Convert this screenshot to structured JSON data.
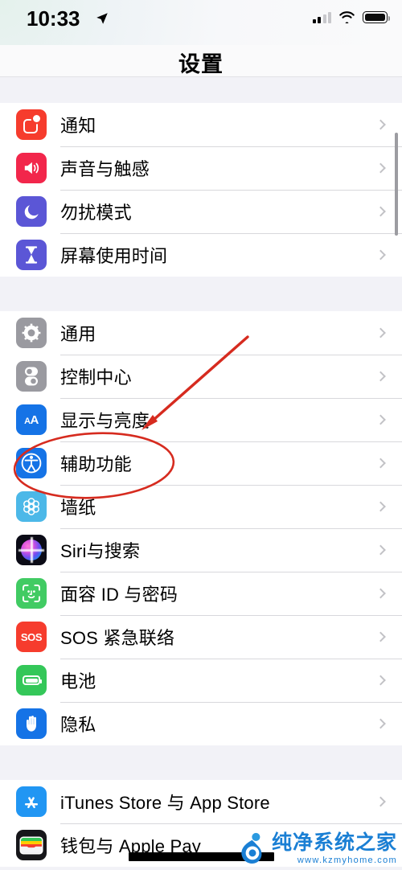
{
  "statusbar": {
    "time": "10:33",
    "location_icon": "location-arrow-icon",
    "signal_icon": "cellular-signal-icon",
    "wifi_icon": "wifi-icon",
    "battery_icon": "battery-icon"
  },
  "navbar": {
    "title": "设置"
  },
  "groups": [
    {
      "name": "group-notifications",
      "rows": [
        {
          "label": "通知",
          "icon": "notifications-icon",
          "icon_class": "ic-notif"
        },
        {
          "label": "声音与触感",
          "icon": "sounds-haptics-icon",
          "icon_class": "ic-sound"
        },
        {
          "label": "勿扰模式",
          "icon": "do-not-disturb-icon",
          "icon_class": "ic-dnd"
        },
        {
          "label": "屏幕使用时间",
          "icon": "screen-time-icon",
          "icon_class": "ic-screen"
        }
      ]
    },
    {
      "name": "group-system",
      "rows": [
        {
          "label": "通用",
          "icon": "general-gear-icon",
          "icon_class": "ic-gen"
        },
        {
          "label": "控制中心",
          "icon": "control-center-icon",
          "icon_class": "ic-cc"
        },
        {
          "label": "显示与亮度",
          "icon": "display-brightness-icon",
          "icon_class": "ic-disp"
        },
        {
          "label": "辅助功能",
          "icon": "accessibility-icon",
          "icon_class": "ic-acc"
        },
        {
          "label": "墙纸",
          "icon": "wallpaper-icon",
          "icon_class": "ic-wall"
        },
        {
          "label": "Siri与搜索",
          "icon": "siri-search-icon",
          "icon_class": "ic-siri"
        },
        {
          "label": "面容 ID 与密码",
          "icon": "face-id-passcode-icon",
          "icon_class": "ic-face"
        },
        {
          "label": "SOS 紧急联络",
          "icon": "emergency-sos-icon",
          "icon_class": "ic-sos"
        },
        {
          "label": "电池",
          "icon": "battery-settings-icon",
          "icon_class": "ic-batt"
        },
        {
          "label": "隐私",
          "icon": "privacy-hand-icon",
          "icon_class": "ic-priv"
        }
      ]
    },
    {
      "name": "group-store",
      "rows": [
        {
          "label": "iTunes Store 与 App Store",
          "icon": "app-store-icon",
          "icon_class": "ic-store"
        },
        {
          "label": "钱包与 Apple Pay",
          "icon": "wallet-icon",
          "icon_class": "ic-wallet"
        }
      ]
    }
  ],
  "annotation": {
    "color": "#d62b1f",
    "highlight_target": "辅助功能",
    "shapes": [
      "arrow",
      "ellipse"
    ],
    "redaction_bar": true
  },
  "watermark": {
    "brand": "纯净系统之家",
    "url": "www.kzmyhome.com",
    "color": "#1a7fd4"
  }
}
